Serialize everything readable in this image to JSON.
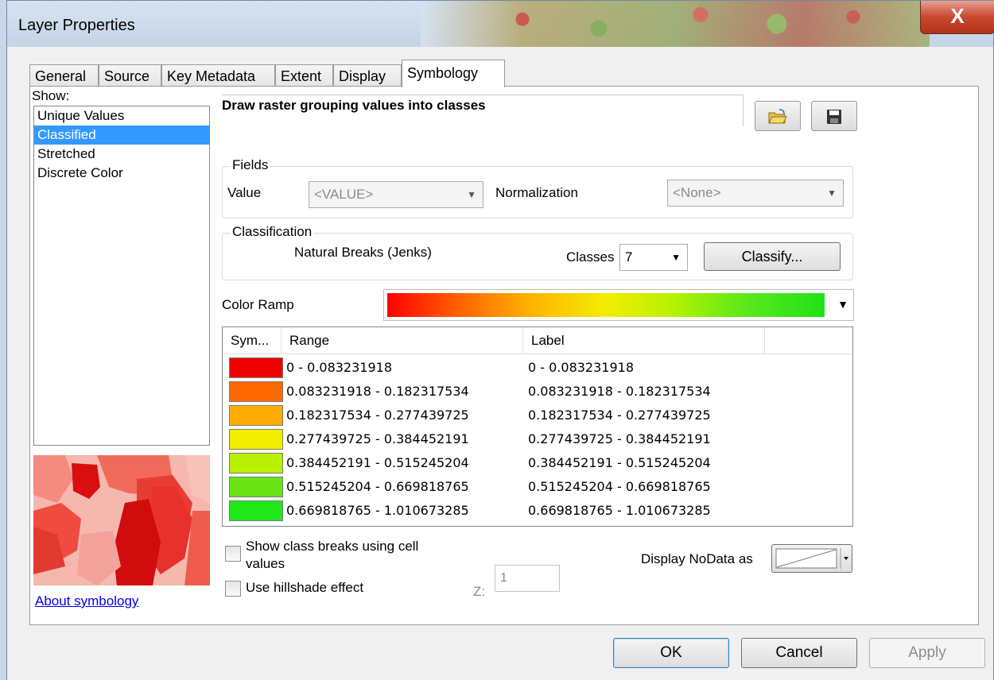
{
  "window": {
    "title": "Layer Properties",
    "close_glyph": "X"
  },
  "tabs": [
    {
      "label": "General"
    },
    {
      "label": "Source"
    },
    {
      "label": "Key Metadata"
    },
    {
      "label": "Extent"
    },
    {
      "label": "Display"
    },
    {
      "label": "Symbology"
    }
  ],
  "active_tab": "Symbology",
  "show": {
    "label": "Show:",
    "items": [
      {
        "label": "Unique Values"
      },
      {
        "label": "Classified"
      },
      {
        "label": "Stretched"
      },
      {
        "label": "Discrete Color"
      }
    ],
    "selected": "Classified"
  },
  "about_link": "About symbology",
  "description": "Draw raster grouping values into classes",
  "fields": {
    "legend": "Fields",
    "value_label": "Value",
    "value_selected": "<VALUE>",
    "normalization_label": "Normalization",
    "normalization_selected": "<None>"
  },
  "classification": {
    "legend": "Classification",
    "method": "Natural Breaks (Jenks)",
    "classes_label": "Classes",
    "classes_value": "7",
    "classify_button": "Classify..."
  },
  "color_ramp": {
    "label": "Color Ramp",
    "colors": [
      "#ff0000",
      "#ff5a00",
      "#ffb000",
      "#f2ee00",
      "#b7f200",
      "#5ae81a",
      "#21e01a"
    ]
  },
  "table": {
    "headers": {
      "symbol": "Sym...",
      "range": "Range",
      "label": "Label"
    },
    "rows": [
      {
        "color": "#ee0000",
        "range": "0 - 0.083231918",
        "label": "0 - 0.083231918"
      },
      {
        "color": "#ff6a00",
        "range": "0.083231918 - 0.182317534",
        "label": "0.083231918 - 0.182317534"
      },
      {
        "color": "#ffac00",
        "range": "0.182317534 - 0.277439725",
        "label": "0.182317534 - 0.277439725"
      },
      {
        "color": "#f2ee00",
        "range": "0.277439725 - 0.384452191",
        "label": "0.277439725 - 0.384452191"
      },
      {
        "color": "#b8f000",
        "range": "0.384452191 - 0.515245204",
        "label": "0.384452191 - 0.515245204"
      },
      {
        "color": "#6ae414",
        "range": "0.515245204 - 0.669818765",
        "label": "0.515245204 - 0.669818765"
      },
      {
        "color": "#1fe81a",
        "range": "0.669818765 - 1.010673285",
        "label": "0.669818765 - 1.010673285"
      }
    ]
  },
  "options": {
    "show_breaks_line1": "Show class breaks using cell",
    "show_breaks_line2": "values",
    "hillshade": "Use hillshade effect",
    "z_label": "Z:",
    "z_value": "1",
    "nodata_label": "Display NoData as"
  },
  "footer": {
    "ok": "OK",
    "cancel": "Cancel",
    "apply": "Apply"
  },
  "icons": {
    "open": "folder-open-icon",
    "save": "save-disk-icon"
  }
}
